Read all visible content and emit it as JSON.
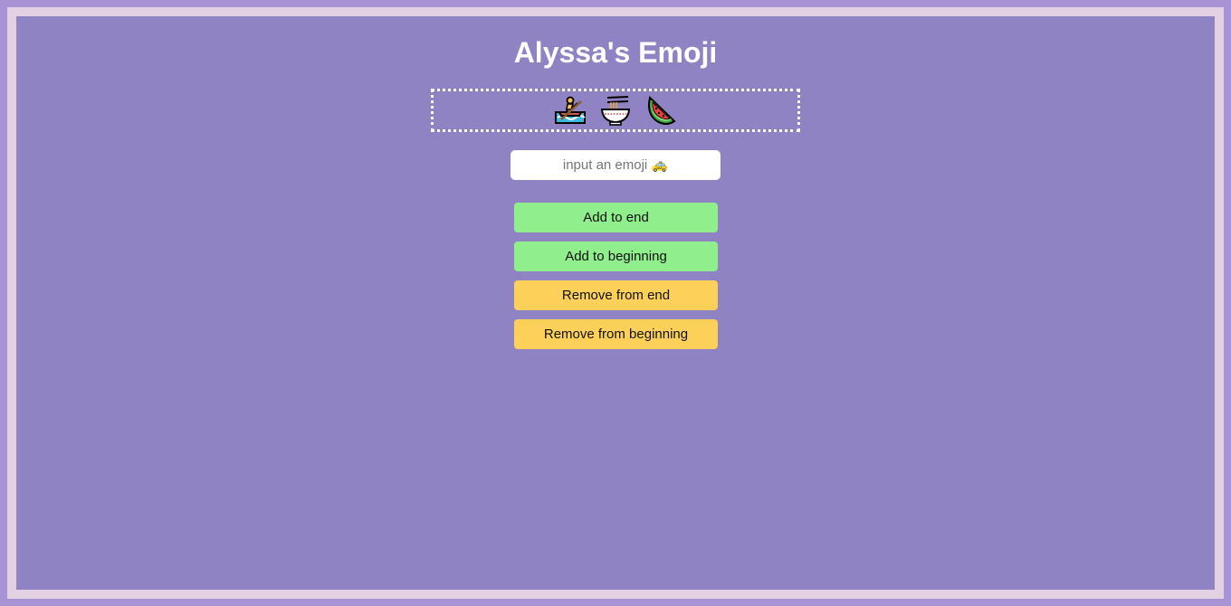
{
  "app": {
    "title": "Alyssa's Emoji"
  },
  "emoji_list": {
    "items": [
      {
        "icon": "person-rowing-boat-icon"
      },
      {
        "icon": "steaming-bowl-icon"
      },
      {
        "icon": "watermelon-icon"
      }
    ]
  },
  "emoji_input": {
    "placeholder": "input an emoji 🚕",
    "value": ""
  },
  "buttons": {
    "add_end": "Add to end",
    "add_beginning": "Add to beginning",
    "remove_end": "Remove from end",
    "remove_beginning": "Remove from beginning"
  },
  "colors": {
    "background": "#8f83c4",
    "frame_border": "#e3d0e3",
    "add_button": "#90ee8c",
    "remove_button": "#fdd05a"
  }
}
